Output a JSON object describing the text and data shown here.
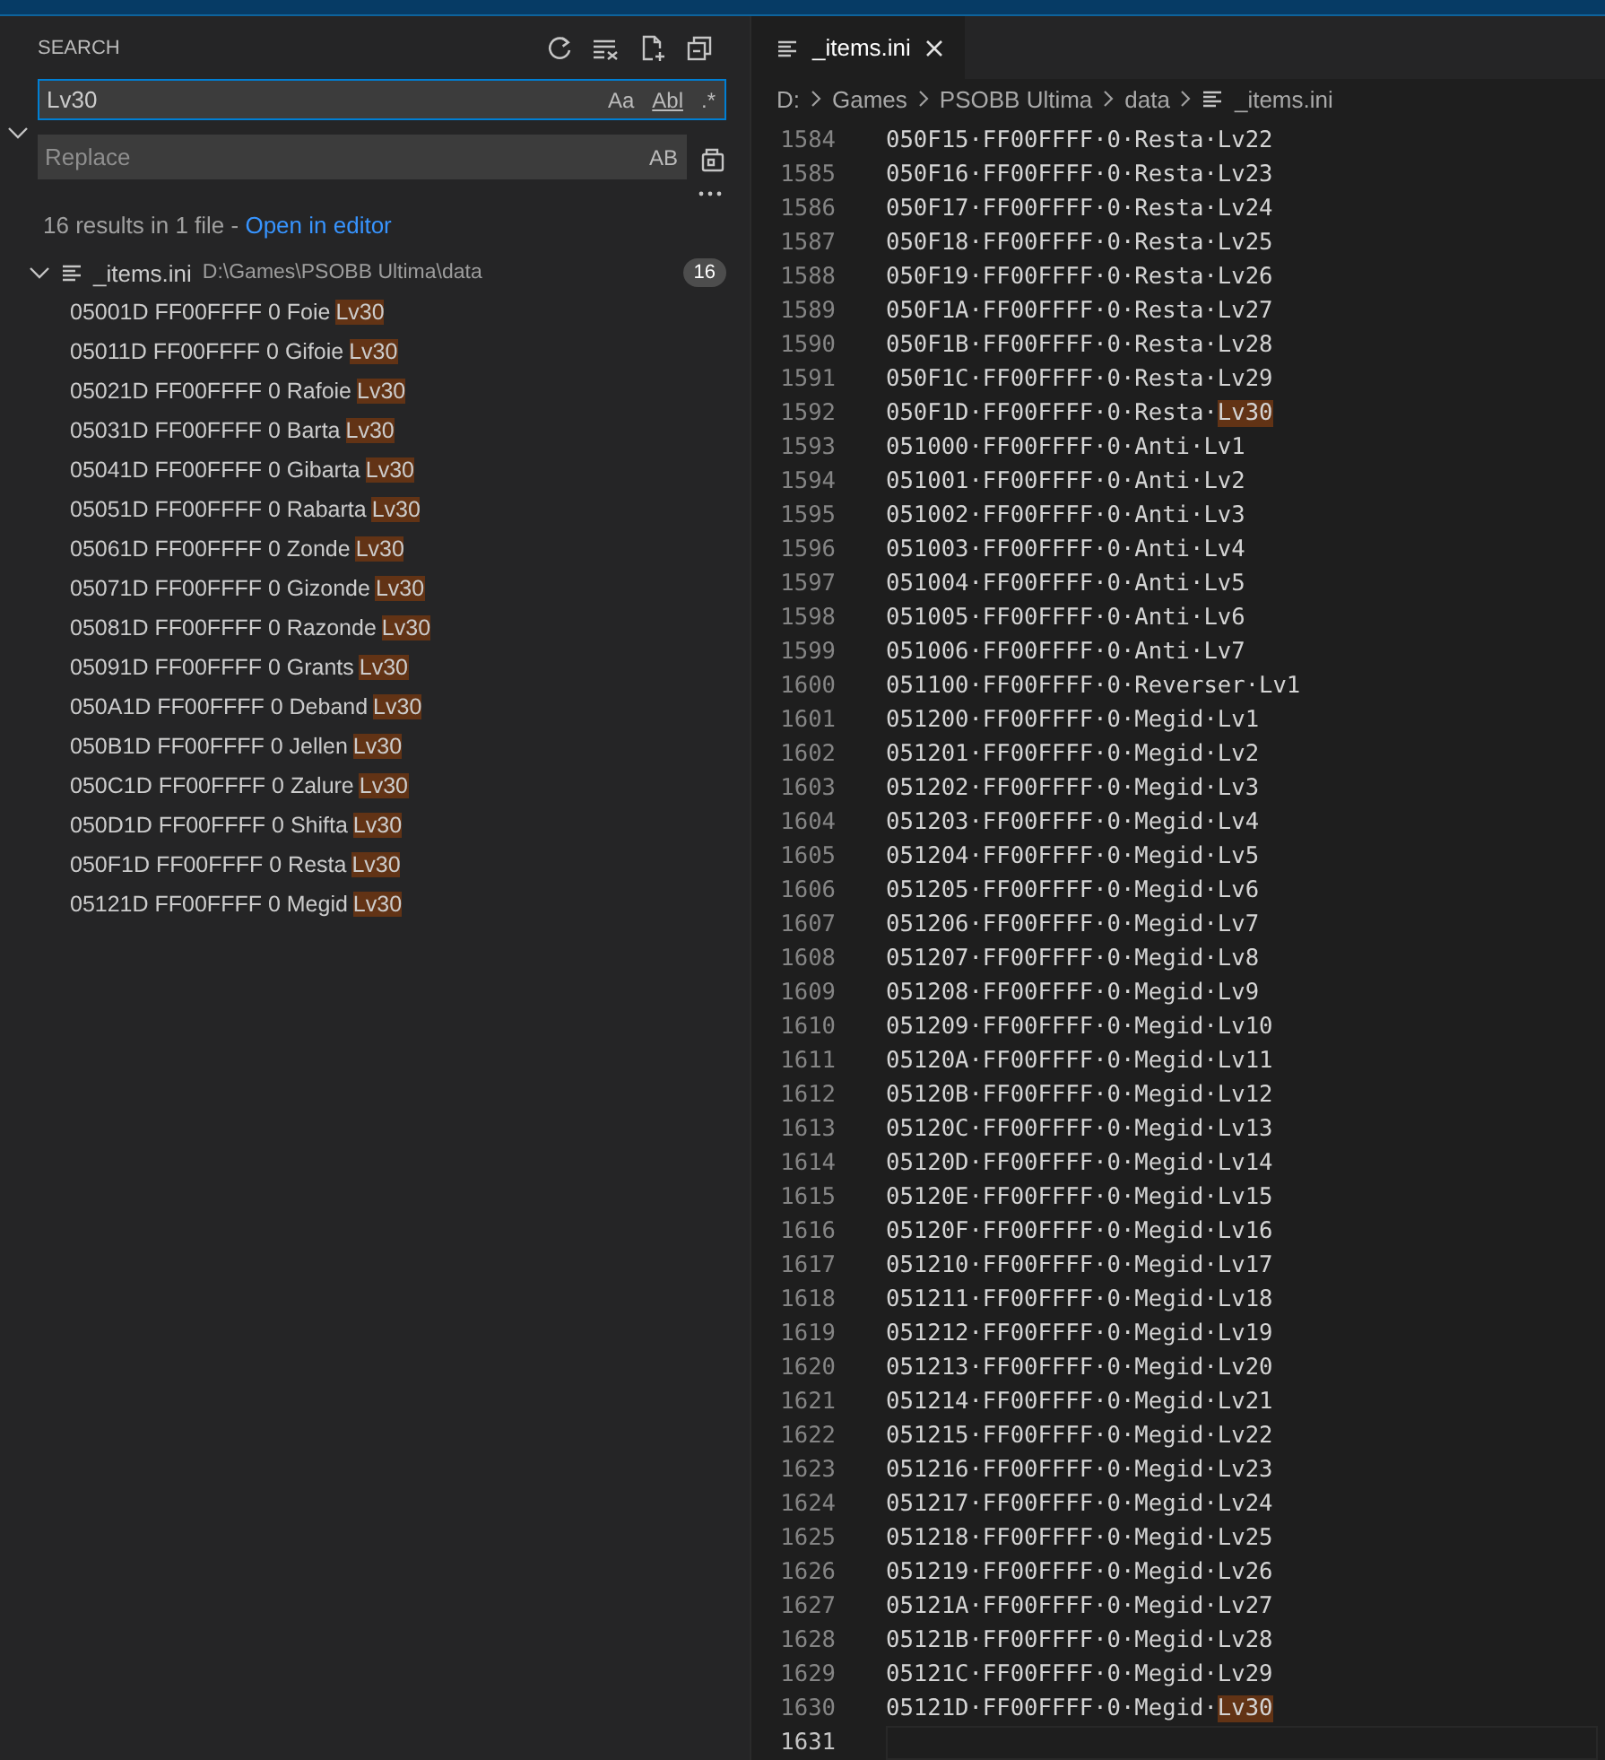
{
  "sidebar": {
    "title": "SEARCH",
    "search": {
      "value": "Lv30",
      "options": [
        {
          "label": "Aa",
          "selected": false
        },
        {
          "label": "Abl",
          "selected": false
        },
        {
          "label": ".*",
          "selected": false
        }
      ]
    },
    "replace": {
      "placeholder": "Replace",
      "option": "AB"
    },
    "summary": "16 results in 1 file - ",
    "open_link": "Open in editor",
    "file": {
      "name": "_items.ini",
      "path": "D:\\Games\\PSOBB Ultima\\data",
      "count": "16",
      "expanded": true,
      "results": [
        {
          "text": "05001D FF00FFFF 0 Foie",
          "match": "Lv30"
        },
        {
          "text": "05011D FF00FFFF 0 Gifoie",
          "match": "Lv30"
        },
        {
          "text": "05021D FF00FFFF 0 Rafoie",
          "match": "Lv30"
        },
        {
          "text": "05031D FF00FFFF 0 Barta",
          "match": "Lv30"
        },
        {
          "text": "05041D FF00FFFF 0 Gibarta",
          "match": "Lv30"
        },
        {
          "text": "05051D FF00FFFF 0 Rabarta",
          "match": "Lv30"
        },
        {
          "text": "05061D FF00FFFF 0 Zonde",
          "match": "Lv30"
        },
        {
          "text": "05071D FF00FFFF 0 Gizonde",
          "match": "Lv30"
        },
        {
          "text": "05081D FF00FFFF 0 Razonde",
          "match": "Lv30"
        },
        {
          "text": "05091D FF00FFFF 0 Grants",
          "match": "Lv30"
        },
        {
          "text": "050A1D FF00FFFF 0 Deband",
          "match": "Lv30"
        },
        {
          "text": "050B1D FF00FFFF 0 Jellen",
          "match": "Lv30"
        },
        {
          "text": "050C1D FF00FFFF 0 Zalure",
          "match": "Lv30"
        },
        {
          "text": "050D1D FF00FFFF 0 Shifta",
          "match": "Lv30"
        },
        {
          "text": "050F1D FF00FFFF 0 Resta",
          "match": "Lv30"
        },
        {
          "text": "05121D FF00FFFF 0 Megid",
          "match": "Lv30"
        }
      ]
    }
  },
  "editor": {
    "tab": {
      "label": "_items.ini",
      "selected": true
    },
    "breadcrumb": [
      "D:",
      "Games",
      "PSOBB Ultima",
      "data",
      "_items.ini"
    ],
    "lines": [
      {
        "number": "1584",
        "text": "050F15·FF00FFFF·0·Resta·Lv22"
      },
      {
        "number": "1585",
        "text": "050F16·FF00FFFF·0·Resta·Lv23"
      },
      {
        "number": "1586",
        "text": "050F17·FF00FFFF·0·Resta·Lv24"
      },
      {
        "number": "1587",
        "text": "050F18·FF00FFFF·0·Resta·Lv25"
      },
      {
        "number": "1588",
        "text": "050F19·FF00FFFF·0·Resta·Lv26"
      },
      {
        "number": "1589",
        "text": "050F1A·FF00FFFF·0·Resta·Lv27"
      },
      {
        "number": "1590",
        "text": "050F1B·FF00FFFF·0·Resta·Lv28"
      },
      {
        "number": "1591",
        "text": "050F1C·FF00FFFF·0·Resta·Lv29"
      },
      {
        "number": "1592",
        "text": "050F1D·FF00FFFF·0·Resta·",
        "match": "Lv30"
      },
      {
        "number": "1593",
        "text": "051000·FF00FFFF·0·Anti·Lv1"
      },
      {
        "number": "1594",
        "text": "051001·FF00FFFF·0·Anti·Lv2"
      },
      {
        "number": "1595",
        "text": "051002·FF00FFFF·0·Anti·Lv3"
      },
      {
        "number": "1596",
        "text": "051003·FF00FFFF·0·Anti·Lv4"
      },
      {
        "number": "1597",
        "text": "051004·FF00FFFF·0·Anti·Lv5"
      },
      {
        "number": "1598",
        "text": "051005·FF00FFFF·0·Anti·Lv6"
      },
      {
        "number": "1599",
        "text": "051006·FF00FFFF·0·Anti·Lv7"
      },
      {
        "number": "1600",
        "text": "051100·FF00FFFF·0·Reverser·Lv1"
      },
      {
        "number": "1601",
        "text": "051200·FF00FFFF·0·Megid·Lv1"
      },
      {
        "number": "1602",
        "text": "051201·FF00FFFF·0·Megid·Lv2"
      },
      {
        "number": "1603",
        "text": "051202·FF00FFFF·0·Megid·Lv3"
      },
      {
        "number": "1604",
        "text": "051203·FF00FFFF·0·Megid·Lv4"
      },
      {
        "number": "1605",
        "text": "051204·FF00FFFF·0·Megid·Lv5"
      },
      {
        "number": "1606",
        "text": "051205·FF00FFFF·0·Megid·Lv6"
      },
      {
        "number": "1607",
        "text": "051206·FF00FFFF·0·Megid·Lv7"
      },
      {
        "number": "1608",
        "text": "051207·FF00FFFF·0·Megid·Lv8"
      },
      {
        "number": "1609",
        "text": "051208·FF00FFFF·0·Megid·Lv9"
      },
      {
        "number": "1610",
        "text": "051209·FF00FFFF·0·Megid·Lv10"
      },
      {
        "number": "1611",
        "text": "05120A·FF00FFFF·0·Megid·Lv11"
      },
      {
        "number": "1612",
        "text": "05120B·FF00FFFF·0·Megid·Lv12"
      },
      {
        "number": "1613",
        "text": "05120C·FF00FFFF·0·Megid·Lv13"
      },
      {
        "number": "1614",
        "text": "05120D·FF00FFFF·0·Megid·Lv14"
      },
      {
        "number": "1615",
        "text": "05120E·FF00FFFF·0·Megid·Lv15"
      },
      {
        "number": "1616",
        "text": "05120F·FF00FFFF·0·Megid·Lv16"
      },
      {
        "number": "1617",
        "text": "051210·FF00FFFF·0·Megid·Lv17"
      },
      {
        "number": "1618",
        "text": "051211·FF00FFFF·0·Megid·Lv18"
      },
      {
        "number": "1619",
        "text": "051212·FF00FFFF·0·Megid·Lv19"
      },
      {
        "number": "1620",
        "text": "051213·FF00FFFF·0·Megid·Lv20"
      },
      {
        "number": "1621",
        "text": "051214·FF00FFFF·0·Megid·Lv21"
      },
      {
        "number": "1622",
        "text": "051215·FF00FFFF·0·Megid·Lv22"
      },
      {
        "number": "1623",
        "text": "051216·FF00FFFF·0·Megid·Lv23"
      },
      {
        "number": "1624",
        "text": "051217·FF00FFFF·0·Megid·Lv24"
      },
      {
        "number": "1625",
        "text": "051218·FF00FFFF·0·Megid·Lv25"
      },
      {
        "number": "1626",
        "text": "051219·FF00FFFF·0·Megid·Lv26"
      },
      {
        "number": "1627",
        "text": "05121A·FF00FFFF·0·Megid·Lv27"
      },
      {
        "number": "1628",
        "text": "05121B·FF00FFFF·0·Megid·Lv28"
      },
      {
        "number": "1629",
        "text": "05121C·FF00FFFF·0·Megid·Lv29"
      },
      {
        "number": "1630",
        "text": "05121D·FF00FFFF·0·Megid·",
        "match": "Lv30"
      },
      {
        "number": "1631",
        "current": true
      }
    ]
  }
}
